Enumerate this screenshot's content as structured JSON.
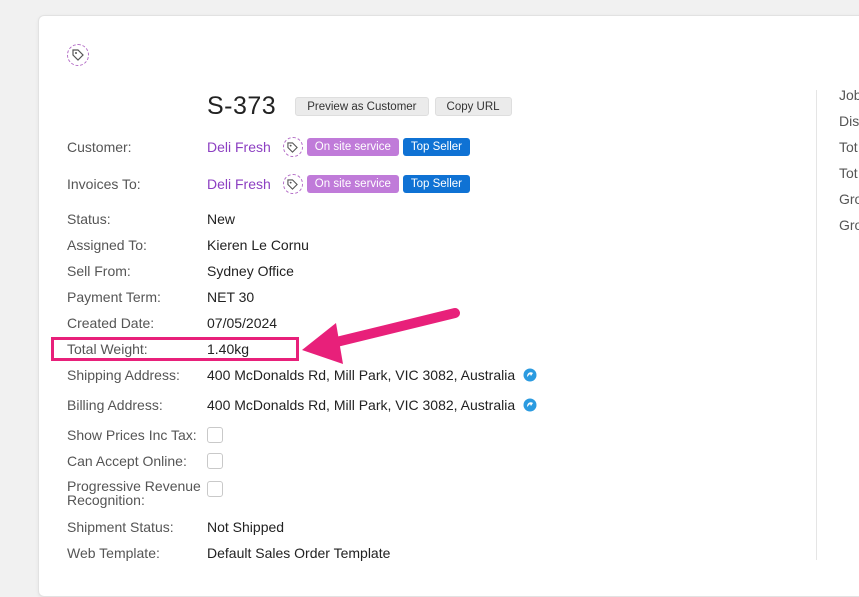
{
  "order": {
    "number": "S-373",
    "preview_label": "Preview as Customer",
    "copy_url_label": "Copy URL"
  },
  "fields": {
    "customer": {
      "label": "Customer:",
      "value": "Deli Fresh"
    },
    "invoices_to": {
      "label": "Invoices To:",
      "value": "Deli Fresh"
    },
    "status": {
      "label": "Status:",
      "value": "New"
    },
    "assigned_to": {
      "label": "Assigned To:",
      "value": "Kieren Le Cornu"
    },
    "sell_from": {
      "label": "Sell From:",
      "value": "Sydney Office"
    },
    "payment_term": {
      "label": "Payment Term:",
      "value": "NET 30"
    },
    "created_date": {
      "label": "Created Date:",
      "value": "07/05/2024"
    },
    "total_weight": {
      "label": "Total Weight:",
      "value": "1.40kg"
    },
    "shipping_address": {
      "label": "Shipping Address:",
      "value": "400 McDonalds Rd, Mill Park, VIC 3082, Australia"
    },
    "billing_address": {
      "label": "Billing Address:",
      "value": "400 McDonalds Rd, Mill Park, VIC 3082, Australia"
    },
    "show_prices_inc_tax": {
      "label": "Show Prices Inc Tax:"
    },
    "can_accept_online": {
      "label": "Can Accept Online:"
    },
    "progressive_revenue": {
      "label_line1": "Progressive Revenue",
      "label_line2": "Recognition:"
    },
    "shipment_status": {
      "label": "Shipment Status:",
      "value": "Not Shipped"
    },
    "web_template": {
      "label": "Web Template:",
      "value": "Default Sales Order Template"
    }
  },
  "badges": {
    "on_site": "On site service",
    "top_seller": "Top Seller"
  },
  "right_column": [
    "Job",
    "Dis",
    "Tot",
    "Tot",
    "Gro",
    "Gro"
  ],
  "colors": {
    "link": "#8c3fc2",
    "badge_purple": "#c07bd9",
    "badge_blue": "#0f72d4",
    "highlight": "#e8207a"
  },
  "icons": [
    "tag-icon",
    "map-pin-icon",
    "arrow-annotation"
  ]
}
